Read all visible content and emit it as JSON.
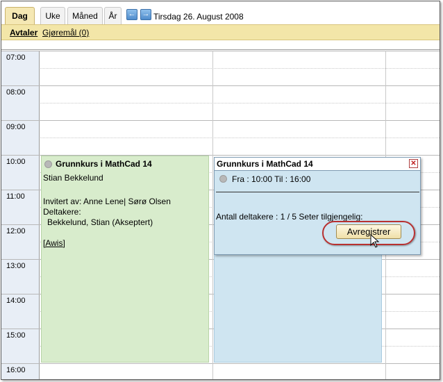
{
  "tabs": [
    "Dag",
    "Uke",
    "Måned",
    "År"
  ],
  "nav": {
    "prev_icon": "arrow-left-icon",
    "next_icon": "arrow-right-icon"
  },
  "date": "Tirsdag 26. August 2008",
  "subnav": {
    "appointments": "Avtaler",
    "todos": "Gjøremål (0)"
  },
  "hours": [
    "07:00",
    "08:00",
    "09:00",
    "10:00",
    "11:00",
    "12:00",
    "13:00",
    "14:00",
    "15:00",
    "16:00"
  ],
  "event": {
    "title": "Grunnkurs i MathCad 14",
    "organizer": "Stian Bekkelund",
    "invited_by": "Invitert av: Anne Lene| Sørø Olsen",
    "participants_label": "Deltakere:",
    "participant": "Bekkelund, Stian (Akseptert)",
    "decline_link": "[Awis]"
  },
  "popup": {
    "title": "Grunnkurs i MathCad 14",
    "time": "Fra : 10:00 Til : 16:00",
    "participants": "Antall deltakere : 1 / 5 Seter tilgjengelig:",
    "unregister_button": "Avregistrer",
    "close_icon": "close-icon"
  },
  "colors": {
    "active_tab": "#f5e8b4",
    "subbar": "#f3e6a8",
    "event_green": "#d8eccc",
    "event_blue": "#cfe5f1",
    "highlight": "#b83030"
  }
}
